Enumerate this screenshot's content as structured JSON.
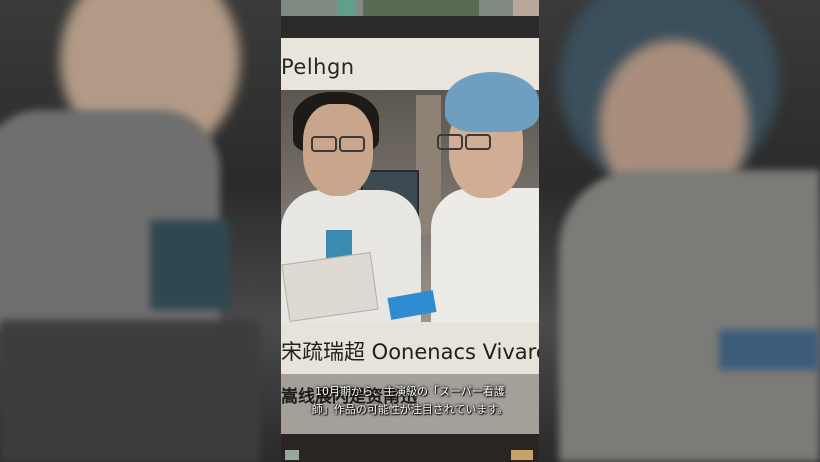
{
  "photo": {
    "banner_text": "Pelhgn",
    "sign_text": "宋疏瑞超 Oonenacs Vivared!",
    "sign2_text": "嵩线展闪是资南迅"
  },
  "caption": {
    "line1": "10月期から、主演級の「スーパー看護",
    "line2": "師」作品の可能性が注目されています。"
  },
  "colors": {
    "coat": "#e8e6e3",
    "scrubs": "#3a8bb0",
    "surgical_cap": "#6f9fc0",
    "sign_background": "#e8e3da"
  }
}
